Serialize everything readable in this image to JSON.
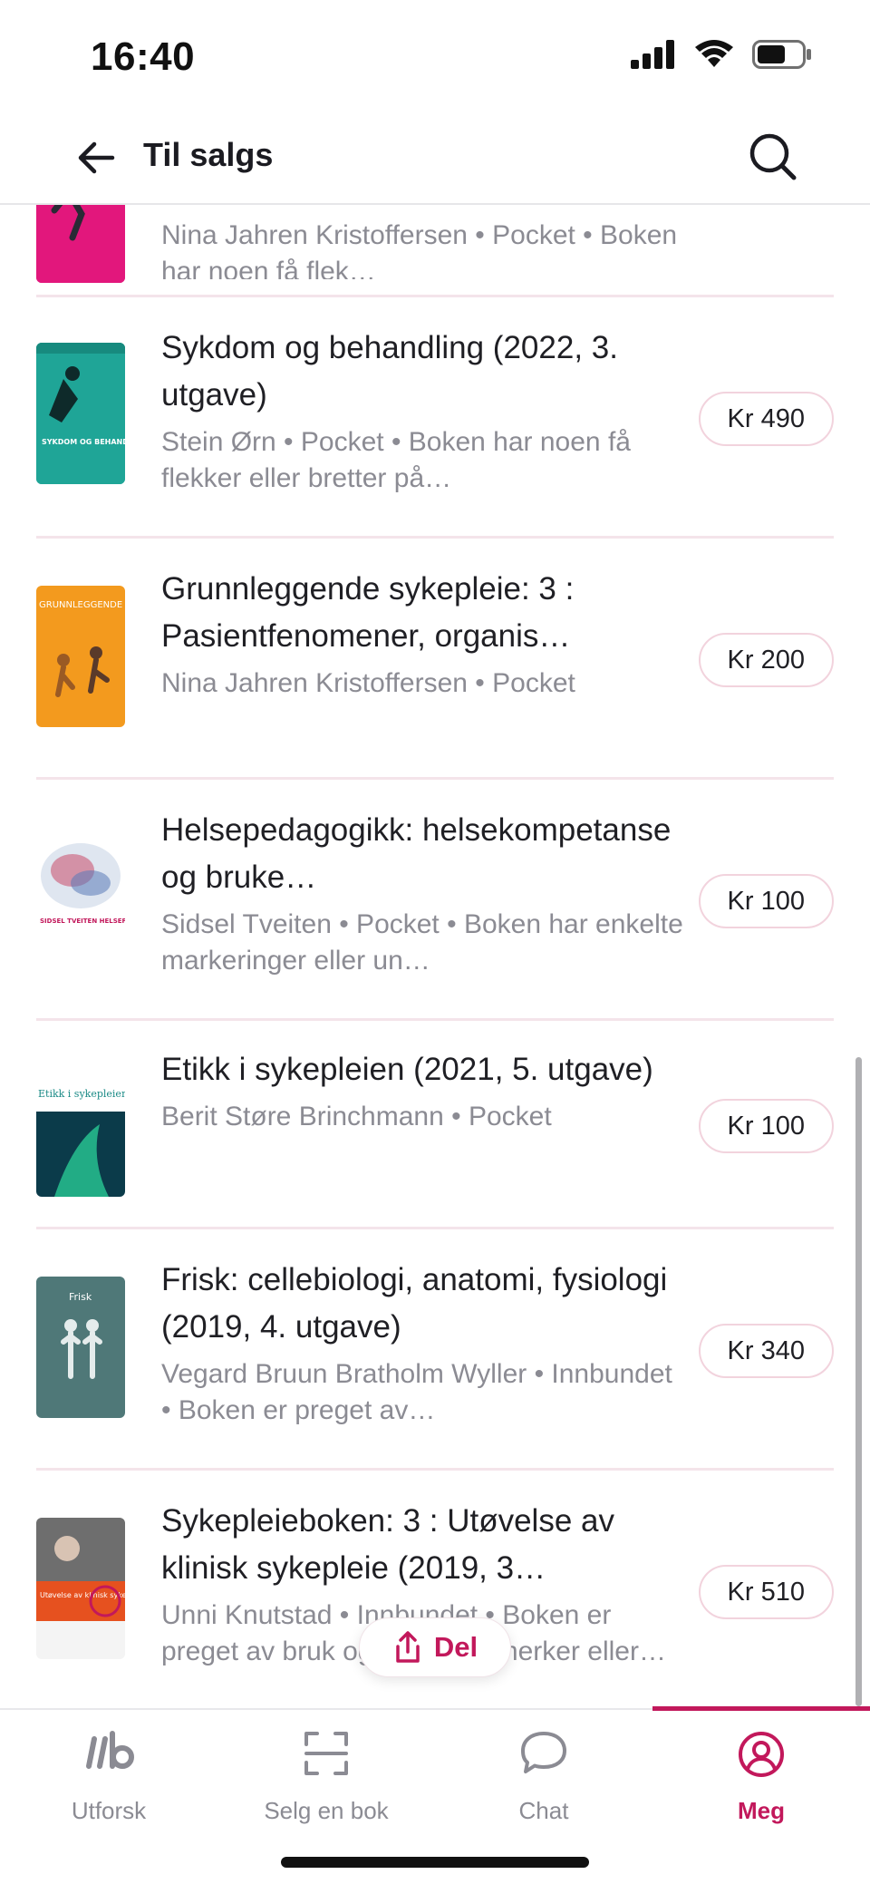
{
  "status_bar": {
    "time": "16:40"
  },
  "header": {
    "title": "Til salgs"
  },
  "listings": [
    {
      "title": "",
      "meta": "Nina Jahren Kristoffersen • Pocket • Boken har noen få flek…",
      "price": ""
    },
    {
      "title": "Sykdom og behandling (2022, 3. utgave)",
      "meta": "Stein Ørn • Pocket • Boken har noen få flekker eller bretter på…",
      "price": "Kr 490",
      "cover_text": "SYKDOM OG BEHANDLING"
    },
    {
      "title": "Grunnleggende sykepleie: 3 : Pasientfenomener, organis…",
      "meta": "Nina Jahren Kristoffersen • Pocket",
      "price": "Kr 200",
      "cover_text": "GRUNNLEGGENDE SYKEPLEIE"
    },
    {
      "title": "Helsepedagogikk: helsekompetanse og bruke…",
      "meta": "Sidsel Tveiten • Pocket • Boken har enkelte markeringer eller un…",
      "price": "Kr 100",
      "cover_text": "SIDSEL TVEITEN HELSEPEDAGOGIKK"
    },
    {
      "title": "Etikk i sykepleien (2021, 5. utgave)",
      "meta": "Berit Støre Brinchmann • Pocket",
      "price": "Kr 100",
      "cover_text": "Etikk i sykepleien"
    },
    {
      "title": "Frisk: cellebiologi, anatomi, fysiologi (2019, 4. utgave)",
      "meta": "Vegard Bruun Bratholm Wyller • Innbundet • Boken er preget av…",
      "price": "Kr 340",
      "cover_text": "Frisk"
    },
    {
      "title": "Sykepleieboken: 3 : Utøvelse av klinisk sykepleie (2019, 3…",
      "meta": "Unni Knutstad • Innbundet • Boken er preget av bruk og har noen merker eller…",
      "price": "Kr 510",
      "cover_text": "Utøvelse av klinisk sykepleie"
    }
  ],
  "share_button": {
    "label": "Del"
  },
  "tab_bar": {
    "tabs": [
      {
        "label": "Utforsk",
        "icon": "lb-logo-icon"
      },
      {
        "label": "Selg en bok",
        "icon": "scan-icon"
      },
      {
        "label": "Chat",
        "icon": "chat-bubble-icon"
      },
      {
        "label": "Meg",
        "icon": "profile-icon",
        "active": true
      }
    ]
  },
  "colors": {
    "accent": "#c2185b",
    "divider": "#f4e4ea",
    "meta_text": "#8b8b93"
  }
}
